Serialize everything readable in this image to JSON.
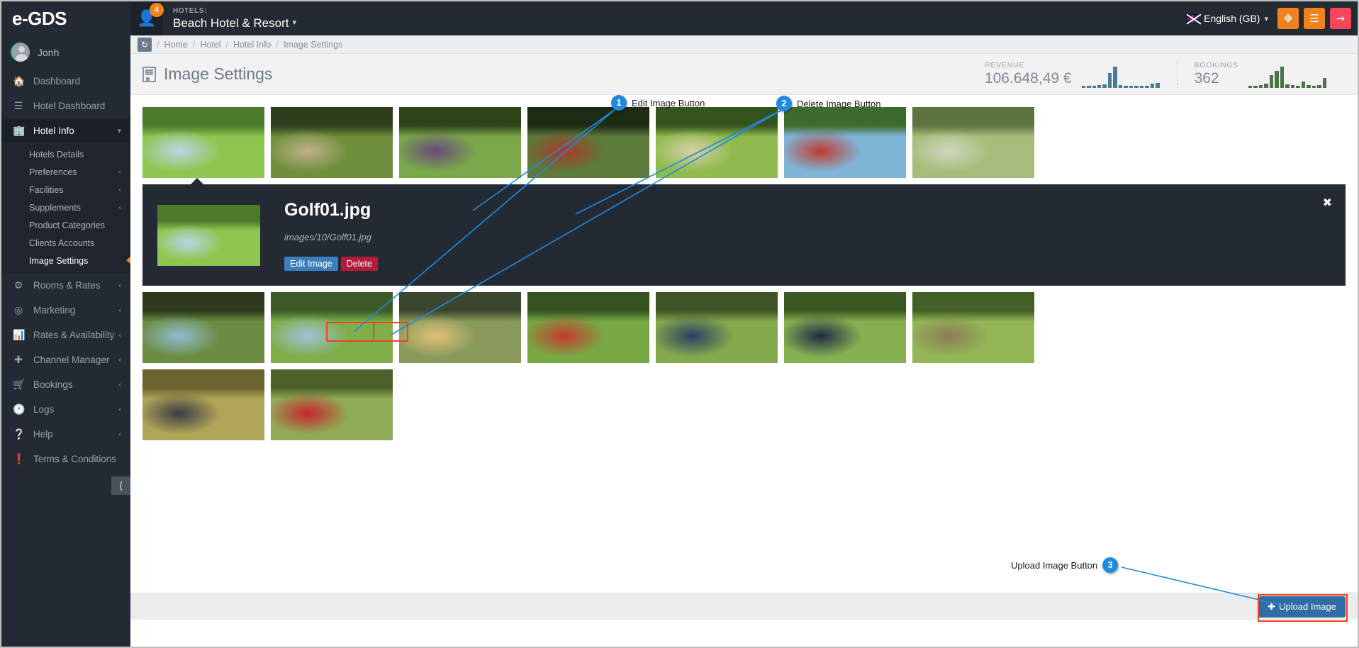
{
  "topbar": {
    "brand": "e-GDS",
    "user_badge_count": "4",
    "user_icon": "user-icon",
    "hotels_label": "HOTELS:",
    "hotel_name": "Beach Hotel & Resort",
    "language": "English (GB)",
    "buttons": [
      {
        "name": "fullscreen-button",
        "icon": "expand-arrows-icon",
        "color": "#f0831e"
      },
      {
        "name": "menu-toggle-button",
        "icon": "hamburger-icon",
        "color": "#f0831e"
      },
      {
        "name": "logout-button",
        "icon": "logout-icon",
        "color": "#f5465c"
      }
    ]
  },
  "sidebar": {
    "profile_name": "Jonh",
    "items": [
      {
        "label": "Dashboard",
        "icon": "home-icon",
        "active": false,
        "chevron": false
      },
      {
        "label": "Hotel Dashboard",
        "icon": "list-icon",
        "active": false,
        "chevron": false
      },
      {
        "label": "Hotel Info",
        "icon": "building-icon",
        "active": true,
        "chevron": true
      },
      {
        "label": "Rooms & Rates",
        "icon": "gears-icon",
        "active": false,
        "chevron": true
      },
      {
        "label": "Marketing",
        "icon": "bullseye-icon",
        "active": false,
        "chevron": true
      },
      {
        "label": "Rates & Availability",
        "icon": "bar-chart-icon",
        "active": false,
        "chevron": true
      },
      {
        "label": "Channel Manager",
        "icon": "arrows-move-icon",
        "active": false,
        "chevron": true
      },
      {
        "label": "Bookings",
        "icon": "cart-icon",
        "active": false,
        "chevron": true
      },
      {
        "label": "Logs",
        "icon": "clock-icon",
        "active": false,
        "chevron": true
      },
      {
        "label": "Help",
        "icon": "question-circle-icon",
        "active": false,
        "chevron": true
      },
      {
        "label": "Terms & Conditions",
        "icon": "info-circle-icon",
        "active": false,
        "chevron": false
      }
    ],
    "submenu": [
      {
        "label": "Hotels Details",
        "current": false
      },
      {
        "label": "Preferences",
        "current": false
      },
      {
        "label": "Facilities",
        "current": false
      },
      {
        "label": "Supplements",
        "current": false
      },
      {
        "label": "Product Categories",
        "current": false
      },
      {
        "label": "Clients Accounts",
        "current": false
      },
      {
        "label": "Image Settings",
        "current": true
      }
    ],
    "collapse_icon": "arrow-circle-left-icon"
  },
  "breadcrumb": {
    "refresh_icon": "refresh-icon",
    "items": [
      "Home",
      "Hotel",
      "Hotel Info",
      "Image Settings"
    ]
  },
  "page": {
    "title": "Image Settings",
    "title_icon": "building-icon"
  },
  "stats": [
    {
      "label": "REVENUE",
      "value": "106.648,49 €",
      "color": "#4a7a94",
      "spark": [
        3,
        3,
        3,
        4,
        5,
        22,
        32,
        4,
        3,
        3,
        3,
        3,
        3,
        6,
        7
      ]
    },
    {
      "label": "BOOKINGS",
      "value": "362",
      "color": "#4c7347",
      "spark": [
        3,
        3,
        4,
        6,
        18,
        24,
        30,
        5,
        4,
        3,
        9,
        4,
        3,
        4,
        14
      ]
    }
  ],
  "gallery": {
    "row1": [
      {
        "name": "golf-player-putting-green",
        "c1": "#8ec64f",
        "c2": "#4a7a2a",
        "c3": "#b9d6e8"
      },
      {
        "name": "golfer-crouching-with-club",
        "c1": "#6f8f3c",
        "c2": "#2e3d1c",
        "c3": "#c2b188"
      },
      {
        "name": "two-golfers-high-five",
        "c1": "#7aa84a",
        "c2": "#2c4418",
        "c3": "#6a4a7a"
      },
      {
        "name": "golf-cart-with-players",
        "c1": "#5c7a3a",
        "c2": "#1d2a14",
        "c3": "#a83a2a"
      },
      {
        "name": "golfer-putting-fairway",
        "c1": "#8fbb4e",
        "c2": "#35531f",
        "c3": "#d8cfa8"
      },
      {
        "name": "golfer-swing-blue-sky",
        "c1": "#7fb6d8",
        "c2": "#3d6b2c",
        "c3": "#c23a30"
      },
      {
        "name": "golf-course-landscape-hills",
        "c1": "#a7bc7a",
        "c2": "#5d7340",
        "c3": "#cfd8c0"
      }
    ],
    "row2": [
      {
        "name": "course-view-through-pines",
        "c1": "#6c8c42",
        "c2": "#2b3a1d",
        "c3": "#93bcd4"
      },
      {
        "name": "fairway-with-bunker",
        "c1": "#7fae4a",
        "c2": "#3c5a26",
        "c3": "#9fc2d8"
      },
      {
        "name": "sunset-over-green-and-lake",
        "c1": "#8a9a5a",
        "c2": "#3a4630",
        "c3": "#e0c27a"
      },
      {
        "name": "golfer-red-shirt-swing",
        "c1": "#77a944",
        "c2": "#35521f",
        "c3": "#c43b2f"
      },
      {
        "name": "golfer-crouched-reading-putt",
        "c1": "#83a84d",
        "c2": "#3d5424",
        "c3": "#2c3f63"
      },
      {
        "name": "golfer-navy-full-swing",
        "c1": "#85b050",
        "c2": "#3b5822",
        "c3": "#1f2a46"
      },
      {
        "name": "olive-tree-on-course",
        "c1": "#93b757",
        "c2": "#435f26",
        "c3": "#8c7a55"
      }
    ],
    "row3": [
      {
        "name": "two-golfers-walking-fairway",
        "c1": "#b0a557",
        "c2": "#6b6330",
        "c3": "#3a3a46"
      },
      {
        "name": "red-flag-on-green",
        "c1": "#8fab56",
        "c2": "#4c6129",
        "c3": "#c8242c"
      }
    ]
  },
  "detail": {
    "title": "Golf01.jpg",
    "path": "images/10/Golf01.jpg",
    "edit_label": "Edit Image",
    "delete_label": "Delete",
    "close_icon": "close-icon",
    "thumb_name": "golf-player-putting-green"
  },
  "footer": {
    "upload_label": "Upload Image",
    "upload_icon": "plus-icon"
  },
  "annotations": [
    {
      "num": "1",
      "text": "Edit Image Button"
    },
    {
      "num": "2",
      "text": "Delete Image Button"
    },
    {
      "num": "3",
      "text": "Upload Image Button"
    }
  ]
}
